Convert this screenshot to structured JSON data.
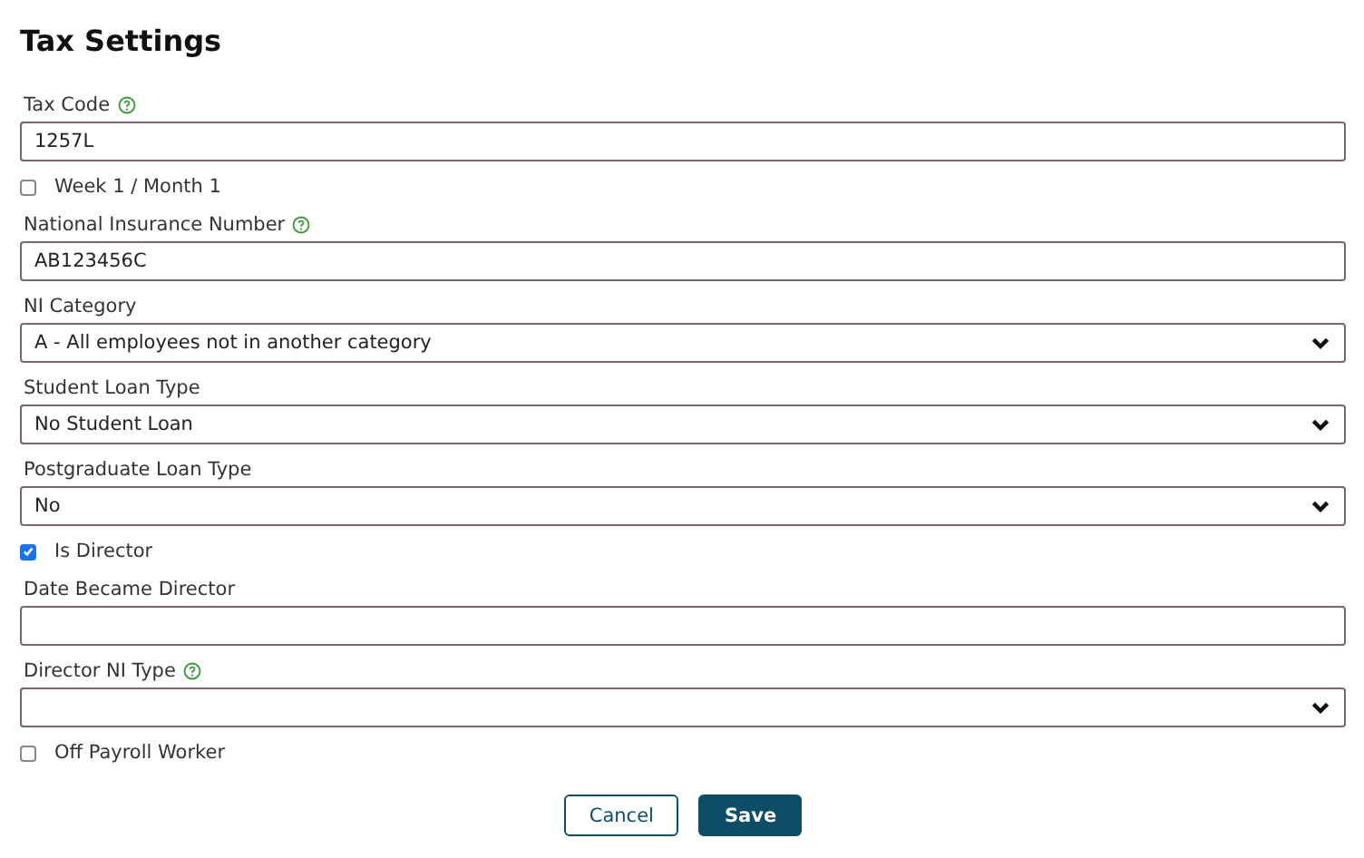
{
  "title": "Tax Settings",
  "fields": [
    {
      "kind": "text",
      "label": "Tax Code",
      "help": true,
      "value": "1257L"
    },
    {
      "kind": "checkbox",
      "label": "Week 1 / Month 1",
      "checked": false
    },
    {
      "kind": "text",
      "label": "National Insurance Number",
      "help": true,
      "value": "AB123456C"
    },
    {
      "kind": "select",
      "label": "NI Category",
      "help": false,
      "value": "A - All employees not in another category"
    },
    {
      "kind": "select",
      "label": "Student Loan Type",
      "help": false,
      "value": "No Student Loan"
    },
    {
      "kind": "select",
      "label": "Postgraduate Loan Type",
      "help": false,
      "value": "No"
    },
    {
      "kind": "checkbox",
      "label": "Is Director",
      "checked": true
    },
    {
      "kind": "text",
      "label": "Date Became Director",
      "help": false
    },
    {
      "kind": "select",
      "label": "Director NI Type",
      "help": true
    },
    {
      "kind": "checkbox",
      "label": "Off Payroll Worker",
      "checked": false
    }
  ],
  "buttons": [
    {
      "label": "Cancel",
      "primary": false
    },
    {
      "label": "Save",
      "primary": true
    }
  ]
}
